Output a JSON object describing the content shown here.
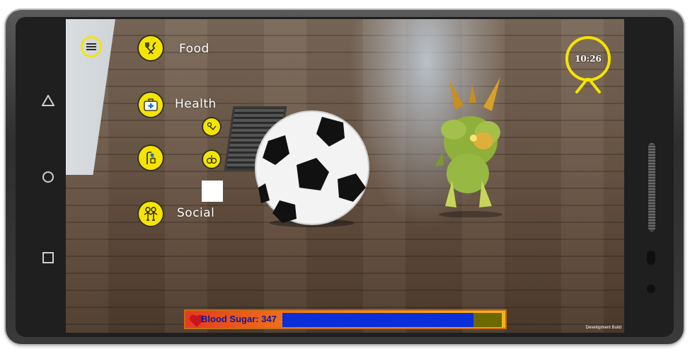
{
  "menu": {
    "icon": "hamburger-icon"
  },
  "needs": [
    {
      "id": "food",
      "label": "Food",
      "icon": "fork-knife-icon"
    },
    {
      "id": "health",
      "label": "Health",
      "icon": "first-aid-kit-icon"
    },
    {
      "id": "hygiene",
      "label": "",
      "icon": "shower-icon"
    },
    {
      "id": "social",
      "label": "Social",
      "icon": "people-icon"
    }
  ],
  "sub_actions": [
    {
      "icon": "play-toy-icon"
    },
    {
      "icon": "balls-icon"
    }
  ],
  "clock": {
    "time": "10:26"
  },
  "status": {
    "label": "Blood Sugar: 347",
    "fill_fraction": 0.87,
    "heart_icon": "heart-icon"
  },
  "dev_build": "Development Build",
  "colors": {
    "accent": "#f4e400",
    "bar_fill": "#0a2fd8",
    "label_text": "#0c1a9a"
  }
}
